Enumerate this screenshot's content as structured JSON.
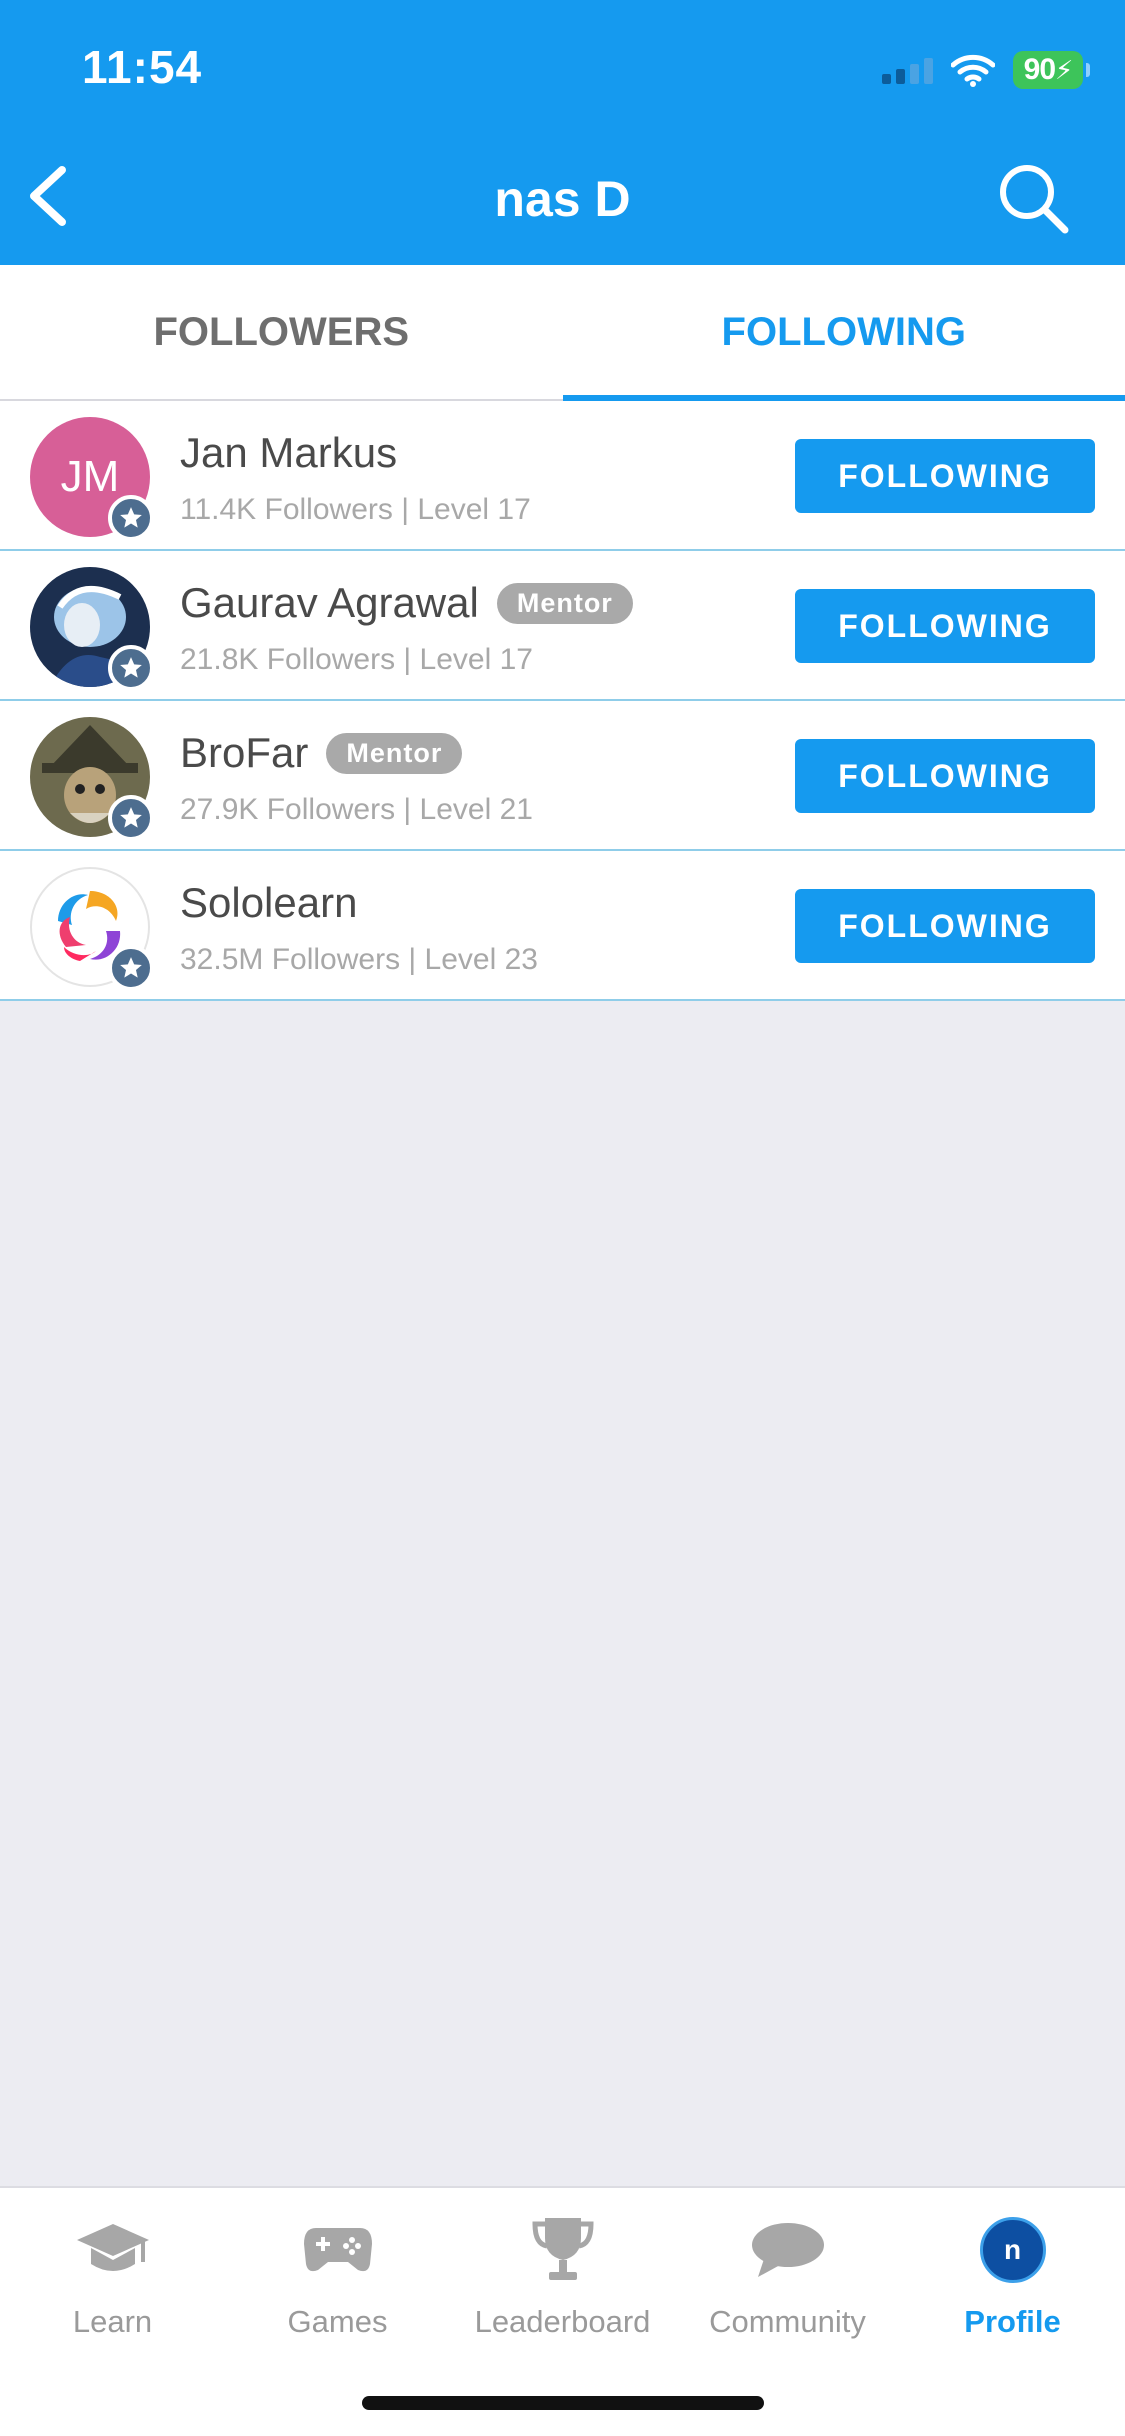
{
  "status_bar": {
    "time": "11:54",
    "battery": "90"
  },
  "header": {
    "title": "nas D",
    "back_icon": "chevron-left-icon",
    "search_icon": "search-icon"
  },
  "tabs": [
    {
      "label": "FOLLOWERS",
      "active": false
    },
    {
      "label": "FOLLOWING",
      "active": true
    }
  ],
  "users": [
    {
      "name": "Jan Markus",
      "initials": "JM",
      "mentor": "",
      "meta": "11.4K Followers | Level 17",
      "button": "FOLLOWING",
      "avatar_color": "#d75f97"
    },
    {
      "name": "Gaurav Agrawal",
      "mentor": "Mentor",
      "meta": "21.8K Followers | Level 17",
      "button": "FOLLOWING"
    },
    {
      "name": "BroFar",
      "mentor": "Mentor",
      "meta": "27.9K Followers | Level 21",
      "button": "FOLLOWING"
    },
    {
      "name": "Sololearn",
      "mentor": "",
      "meta": "32.5M Followers | Level 23",
      "button": "FOLLOWING"
    }
  ],
  "bottom_nav": [
    {
      "label": "Learn",
      "icon": "graduation-cap-icon"
    },
    {
      "label": "Games",
      "icon": "gamepad-icon"
    },
    {
      "label": "Leaderboard",
      "icon": "trophy-icon"
    },
    {
      "label": "Community",
      "icon": "chat-bubble-icon"
    },
    {
      "label": "Profile",
      "icon": "avatar-icon",
      "avatar_letter": "n",
      "active": true
    }
  ],
  "colors": {
    "primary": "#159aef",
    "background": "#ececf2",
    "mentor_badge": "#a9a9a9",
    "star_badge": "#4d6d8f"
  }
}
